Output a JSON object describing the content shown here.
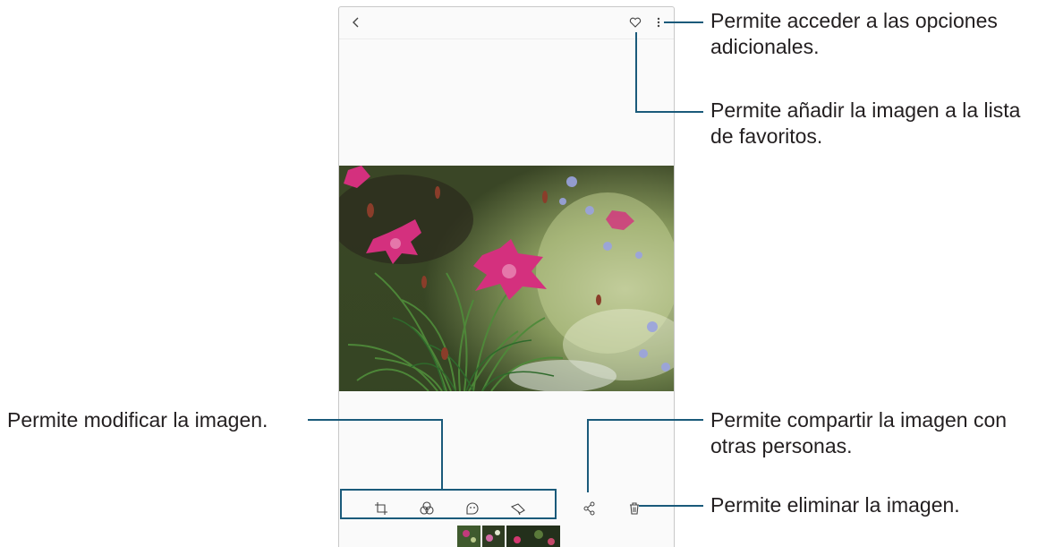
{
  "callouts": {
    "options": [
      "Permite acceder a las opciones",
      "adicionales."
    ],
    "favorite": [
      "Permite añadir la imagen a la lista",
      "de favoritos."
    ],
    "edit": "Permite modificar la imagen.",
    "share": [
      "Permite compartir la imagen con",
      "otras personas."
    ],
    "delete": "Permite eliminar la imagen."
  },
  "topbar": {
    "back_icon": "chevron-left-icon",
    "favorite_icon": "heart-icon",
    "more_icon": "more-vertical-icon"
  },
  "toolbar": {
    "icons": [
      "crop-rotate-icon",
      "filter-icon",
      "sticker-icon",
      "brush-icon",
      "share-icon",
      "trash-icon"
    ]
  },
  "colors": {
    "callout_line": "#1a5a7a",
    "text": "#231f20"
  }
}
